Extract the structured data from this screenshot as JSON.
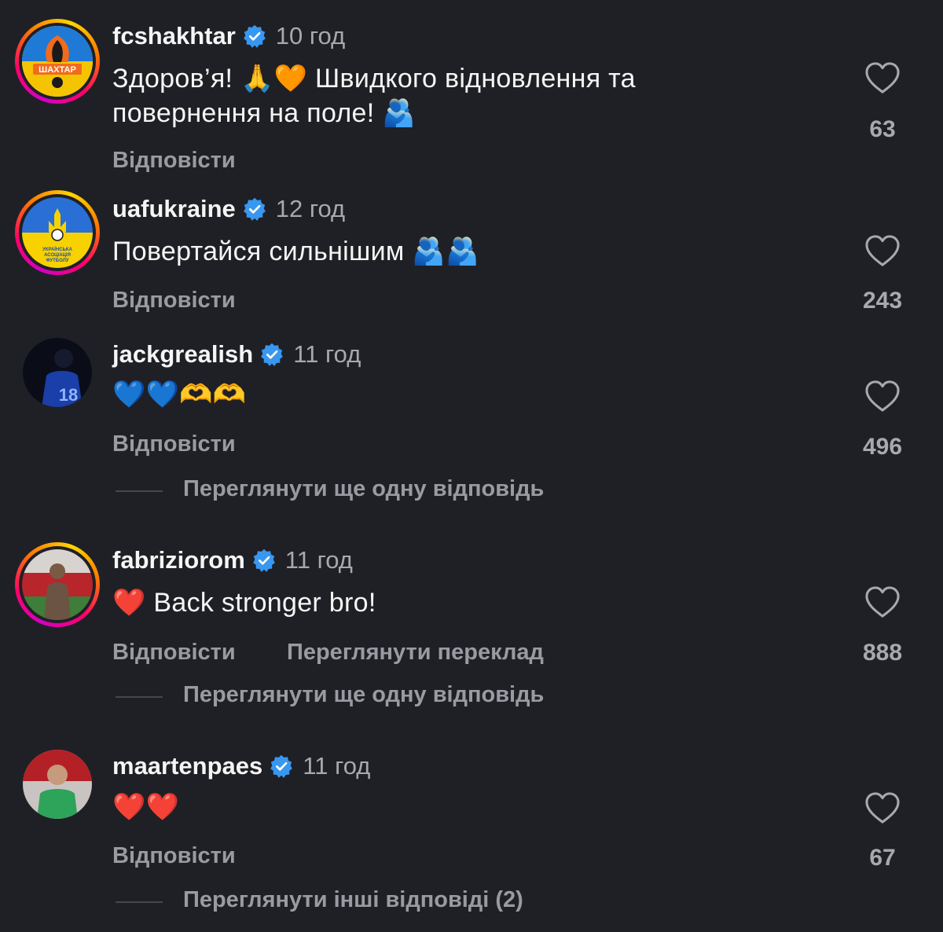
{
  "comments": [
    {
      "username": "fcshakhtar",
      "time": "10 год",
      "text": "Здоров’я! 🙏🧡 Швидкого відновлення та повернення на поле! 🫂",
      "likes": "63",
      "reply_label": "Відповісти",
      "avatar_text": "ШАХТАР"
    },
    {
      "username": "uafukraine",
      "time": "12 год",
      "text": "Повертайся сильнішим 🫂🫂",
      "likes": "243",
      "reply_label": "Відповісти",
      "avatar_text": "УКРАЇНСЬКА АСОЦІАЦІЯ ФУТБОЛУ"
    },
    {
      "username": "jackgrealish",
      "time": "11 год",
      "text": "💙💙🫶🫶",
      "likes": "496",
      "reply_label": "Відповісти",
      "more_replies": "Переглянути ще одну відповідь",
      "avatar_text": "18"
    },
    {
      "username": "fabriziorom",
      "time": "11 год",
      "text": "❤️ Back stronger bro!",
      "likes": "888",
      "reply_label": "Відповісти",
      "translate_label": "Переглянути переклад",
      "more_replies": "Переглянути ще одну відповідь"
    },
    {
      "username": "maartenpaes",
      "time": "11 год",
      "text": "❤️❤️",
      "likes": "67",
      "reply_label": "Відповісти",
      "more_replies": "Переглянути інші відповіді (2)"
    }
  ],
  "colors": {
    "background": "#1f2025",
    "verified": "#3897f0",
    "muted": "#9a9aa1"
  },
  "icons": [
    "verified-badge-icon",
    "heart-outline-icon"
  ]
}
